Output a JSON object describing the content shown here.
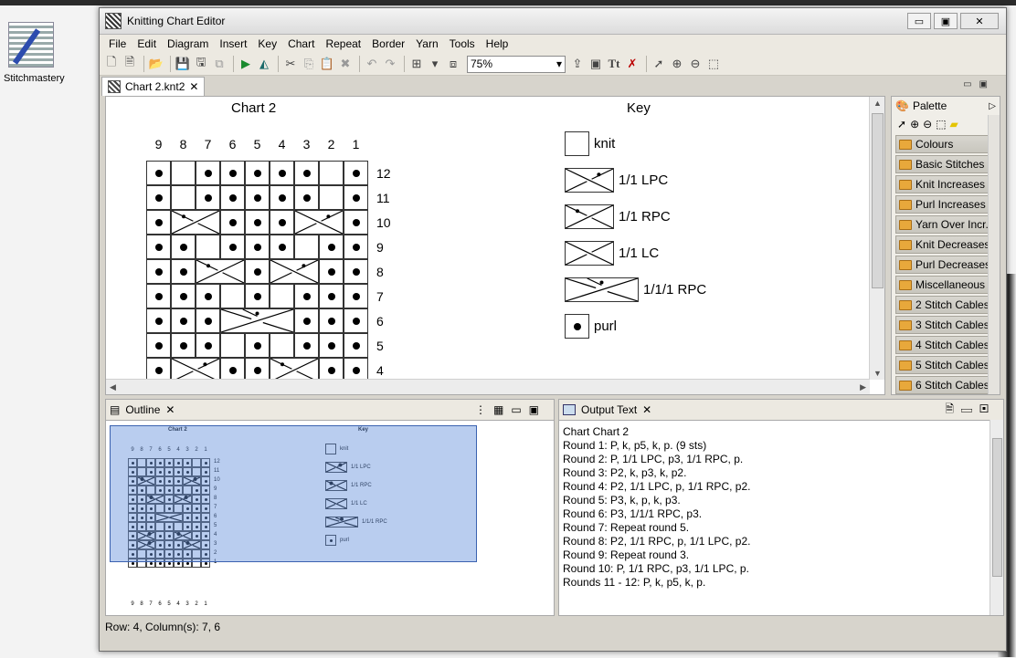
{
  "desktop": {
    "icon_label": "Stitchmastery"
  },
  "window": {
    "title": "Knitting Chart Editor",
    "buttons": {
      "minimize": "▭",
      "maximize": "▣",
      "close": "✕"
    }
  },
  "menu": [
    "File",
    "Edit",
    "Diagram",
    "Insert",
    "Key",
    "Chart",
    "Repeat",
    "Border",
    "Yarn",
    "Tools",
    "Help"
  ],
  "toolbar": {
    "zoom_value": "75%"
  },
  "editor_tab": {
    "label": "Chart 2.knt2",
    "close": "✕"
  },
  "chart": {
    "title": "Chart 2",
    "key_title": "Key",
    "column_labels": [
      "9",
      "8",
      "7",
      "6",
      "5",
      "4",
      "3",
      "2",
      "1"
    ],
    "row_labels": [
      "12",
      "11",
      "10",
      "9",
      "8",
      "7",
      "6",
      "5",
      "4"
    ],
    "rows": [
      [
        "p",
        "k",
        "p",
        "p",
        "p",
        "p",
        "p",
        "k",
        "p"
      ],
      [
        "p",
        "k",
        "p",
        "p",
        "p",
        "p",
        "p",
        "k",
        "p"
      ],
      [
        "p",
        "rpc",
        "rpc",
        "p",
        "p",
        "p",
        "lpc",
        "lpc",
        "p"
      ],
      [
        "p",
        "p",
        "k",
        "p",
        "p",
        "p",
        "k",
        "p",
        "p"
      ],
      [
        "p",
        "p",
        "rpc",
        "rpc",
        "p",
        "lpc",
        "lpc",
        "p",
        "p"
      ],
      [
        "p",
        "p",
        "p",
        "k",
        "p",
        "k",
        "p",
        "p",
        "p"
      ],
      [
        "p",
        "p",
        "p",
        "c3",
        "c3",
        "c3",
        "p",
        "p",
        "p"
      ],
      [
        "p",
        "p",
        "p",
        "k",
        "p",
        "k",
        "p",
        "p",
        "p"
      ],
      [
        "p",
        "lpc",
        "lpc",
        "p",
        "p",
        "rpc",
        "rpc",
        "p",
        "p"
      ]
    ]
  },
  "key": [
    {
      "label": "knit",
      "kind": "knit"
    },
    {
      "label": "1/1 LPC",
      "kind": "lpc"
    },
    {
      "label": "1/1 RPC",
      "kind": "rpc"
    },
    {
      "label": "1/1 LC",
      "kind": "lc"
    },
    {
      "label": "1/1/1 RPC",
      "kind": "c3"
    },
    {
      "label": "purl",
      "kind": "purl"
    }
  ],
  "palette": {
    "title": "Palette",
    "items": [
      "Colours",
      "Basic Stitches",
      "Knit Increases",
      "Purl Increases",
      "Yarn Over Incr...",
      "Knit Decreases",
      "Purl Decreases",
      "Miscellaneous",
      "2 Stitch Cables",
      "3 Stitch Cables",
      "4 Stitch Cables",
      "5 Stitch Cables",
      "6 Stitch Cables"
    ]
  },
  "outline": {
    "tab_label": "Outline",
    "close": "✕",
    "mini_title": "Chart 2",
    "mini_key": "Key",
    "mini_key_labels": [
      "knit",
      "1/1 LPC",
      "1/1 RPC",
      "1/1 LC",
      "1/1/1 RPC",
      "purl"
    ],
    "mini_row_labels": [
      "12",
      "11",
      "10",
      "9",
      "8",
      "7",
      "6",
      "5",
      "4",
      "3",
      "2",
      "1"
    ],
    "mini_col_labels": [
      "9",
      "8",
      "7",
      "6",
      "5",
      "4",
      "3",
      "2",
      "1"
    ]
  },
  "output": {
    "tab_label": "Output Text",
    "close": "✕",
    "lines": [
      "Chart Chart 2",
      "Round 1: P, k, p5, k, p. (9 sts)",
      "Round 2: P, 1/1 LPC, p3, 1/1 RPC, p.",
      "Round 3: P2, k, p3, k, p2.",
      "Round 4: P2, 1/1 LPC, p, 1/1 RPC, p2.",
      "Round 5: P3, k, p, k, p3.",
      "Round 6: P3, 1/1/1 RPC, p3.",
      "Round 7: Repeat round 5.",
      "Round 8: P2, 1/1 RPC, p, 1/1 LPC, p2.",
      "Round 9: Repeat round 3.",
      "Round 10: P, 1/1 RPC, p3, 1/1 LPC, p.",
      "Rounds 11 - 12: P, k, p5, k, p."
    ]
  },
  "status": {
    "text": "Row: 4, Column(s): 7, 6"
  }
}
